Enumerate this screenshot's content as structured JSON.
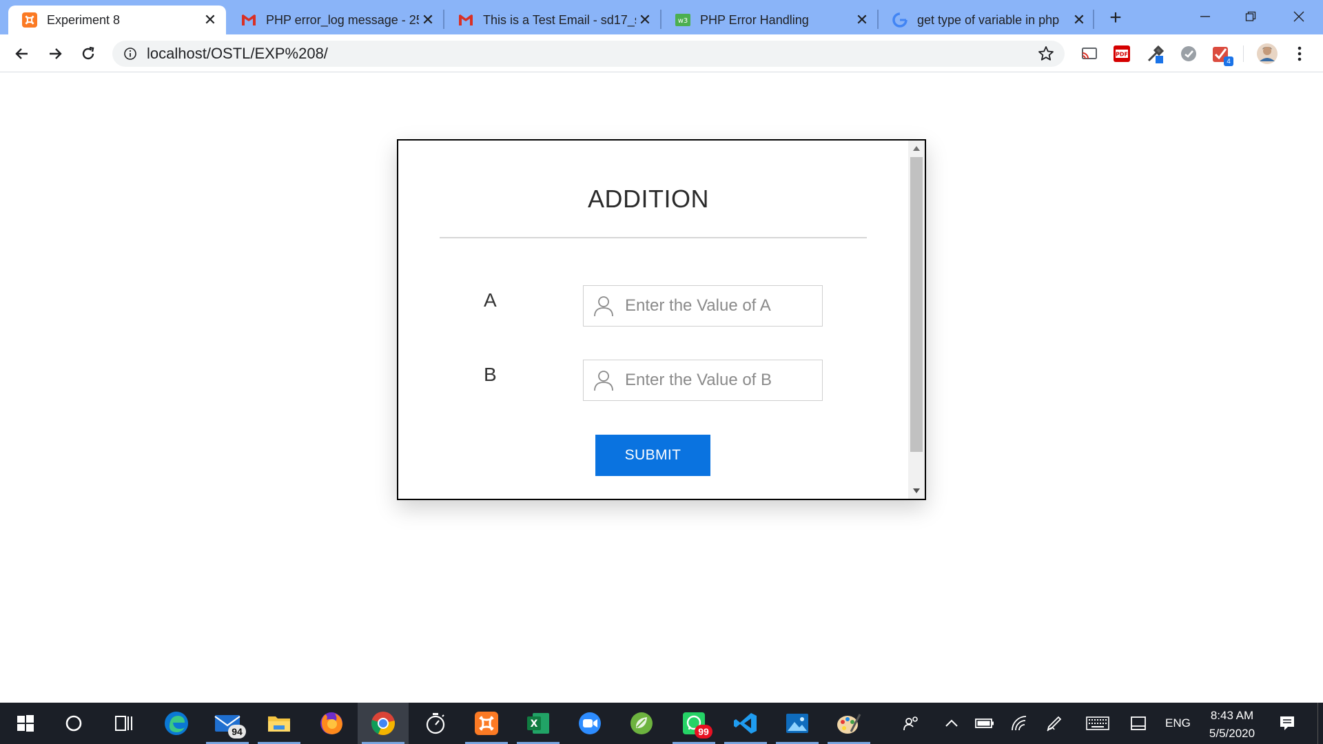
{
  "browser": {
    "tabs": [
      {
        "title": "Experiment 8",
        "favicon": "xampp-icon",
        "active": true
      },
      {
        "title": "PHP error_log message - 25",
        "favicon": "gmail-icon",
        "active": false
      },
      {
        "title": "This is a Test Email - sd17_s",
        "favicon": "gmail-icon",
        "active": false
      },
      {
        "title": "PHP Error Handling",
        "favicon": "w3schools-icon",
        "active": false
      },
      {
        "title": "get type of variable in php",
        "favicon": "google-icon",
        "active": false
      }
    ],
    "url": "localhost/OSTL/EXP%208/",
    "extensions": [
      {
        "name": "cast-icon"
      },
      {
        "name": "pdf-icon",
        "label": "PDF"
      },
      {
        "name": "eyedropper-icon"
      },
      {
        "name": "circle-ext-icon"
      },
      {
        "name": "todo-check-icon",
        "badge": "4"
      },
      {
        "name": "profile-avatar"
      }
    ]
  },
  "page": {
    "title": "ADDITION",
    "fields": [
      {
        "label": "A",
        "placeholder": "Enter the Value of A"
      },
      {
        "label": "B",
        "placeholder": "Enter the Value of B"
      }
    ],
    "submit_label": "SUBMIT",
    "accent": "#0a73e0"
  },
  "taskbar": {
    "apps": [
      {
        "name": "start-icon"
      },
      {
        "name": "search-circle-icon"
      },
      {
        "name": "task-view-icon"
      },
      {
        "name": "edge-icon"
      },
      {
        "name": "mail-icon",
        "badge": "94"
      },
      {
        "name": "file-explorer-icon"
      },
      {
        "name": "firefox-icon"
      },
      {
        "name": "chrome-icon"
      },
      {
        "name": "stopwatch-icon"
      },
      {
        "name": "xampp-icon"
      },
      {
        "name": "excel-icon"
      },
      {
        "name": "zoom-icon"
      },
      {
        "name": "spring-tool-icon"
      },
      {
        "name": "whatsapp-icon",
        "badge": "99"
      },
      {
        "name": "vscode-icon"
      },
      {
        "name": "photos-icon"
      },
      {
        "name": "paint-icon"
      }
    ],
    "language": "ENG",
    "time": "8:43 AM",
    "date": "5/5/2020"
  }
}
